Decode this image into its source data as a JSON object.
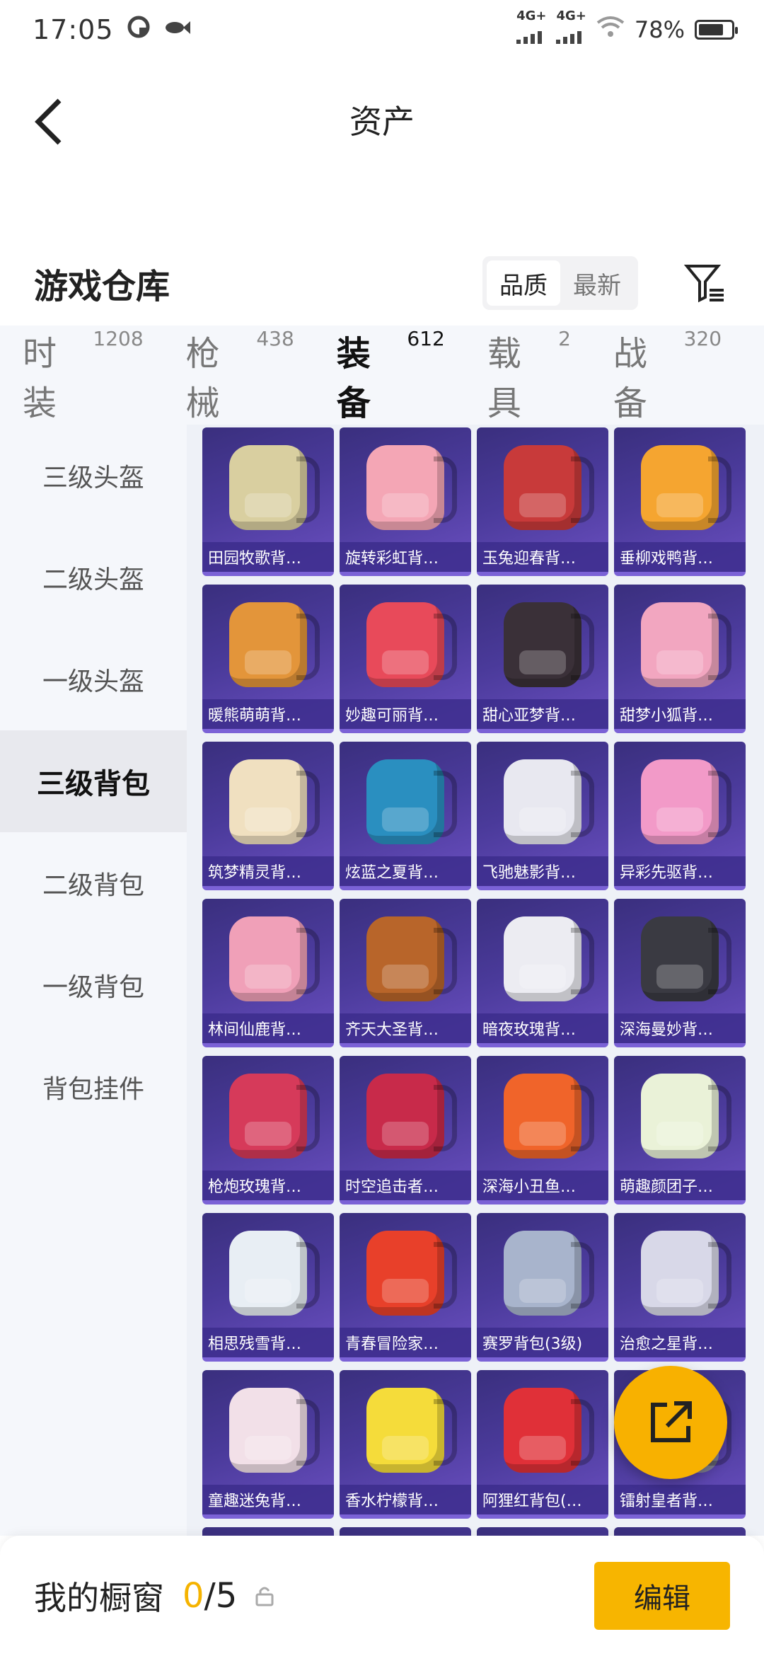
{
  "status": {
    "time": "17:05",
    "signal1": "4G+",
    "signal2": "4G+",
    "battery": "78%",
    "battery_level": 0.78
  },
  "header": {
    "title": "资产",
    "back_icon": "chevron-left-icon"
  },
  "warehouse": {
    "title": "游戏仓库",
    "sort_options": [
      "品质",
      "最新"
    ],
    "filter_icon": "filter-icon"
  },
  "tabs": [
    {
      "label": "时装",
      "count": "1208"
    },
    {
      "label": "枪械",
      "count": "438"
    },
    {
      "label": "装备",
      "count": "612"
    },
    {
      "label": "载具",
      "count": "2"
    },
    {
      "label": "战备",
      "count": "320"
    }
  ],
  "sidebar": {
    "items": [
      "三级头盔",
      "二级头盔",
      "一级头盔",
      "三级背包",
      "二级背包",
      "一级背包",
      "背包挂件"
    ]
  },
  "items": [
    {
      "name": "田园牧歌背…",
      "color": "#d9cfa0"
    },
    {
      "name": "旋转彩虹背…",
      "color": "#f4a6b5"
    },
    {
      "name": "玉兔迎春背…",
      "color": "#c83a3a"
    },
    {
      "name": "垂柳戏鸭背…",
      "color": "#f5a530"
    },
    {
      "name": "暖熊萌萌背…",
      "color": "#e3953a"
    },
    {
      "name": "妙趣可丽背…",
      "color": "#e84a5a"
    },
    {
      "name": "甜心亚梦背…",
      "color": "#3a3038"
    },
    {
      "name": "甜梦小狐背…",
      "color": "#f2a6c0"
    },
    {
      "name": "筑梦精灵背…",
      "color": "#f0e0c0"
    },
    {
      "name": "炫蓝之夏背…",
      "color": "#2a8fc0"
    },
    {
      "name": "飞驰魅影背…",
      "color": "#e8e8f0"
    },
    {
      "name": "异彩先驱背…",
      "color": "#f29ac8"
    },
    {
      "name": "林间仙鹿背…",
      "color": "#f0a0b8"
    },
    {
      "name": "齐天大圣背…",
      "color": "#b8652a"
    },
    {
      "name": "暗夜玫瑰背…",
      "color": "#ececf2"
    },
    {
      "name": "深海曼妙背…",
      "color": "#3a3a42"
    },
    {
      "name": "枪炮玫瑰背…",
      "color": "#d63a5a"
    },
    {
      "name": "时空追击者…",
      "color": "#c82a4a"
    },
    {
      "name": "深海小丑鱼…",
      "color": "#f0642a"
    },
    {
      "name": "萌趣颜团子…",
      "color": "#eaf2d8"
    },
    {
      "name": "相思残雪背…",
      "color": "#e8eef4"
    },
    {
      "name": "青春冒险家…",
      "color": "#e8402a"
    },
    {
      "name": "赛罗背包(3级)",
      "color": "#a8b4cc"
    },
    {
      "name": "治愈之星背…",
      "color": "#d8d8e8"
    },
    {
      "name": "童趣迷兔背…",
      "color": "#f2e0e8"
    },
    {
      "name": "香水柠檬背…",
      "color": "#f5dc3a"
    },
    {
      "name": "阿狸红背包(…",
      "color": "#e03038"
    },
    {
      "name": "镭射皇者背…",
      "color": "#9a9ab0"
    }
  ],
  "fab": {
    "icon": "share-external-icon"
  },
  "bottom": {
    "label": "我的橱窗",
    "count_current": "0",
    "count_total": "/5",
    "edit_label": "编辑"
  },
  "colors": {
    "accent": "#f7b500",
    "card_bg": "#4a3a9a",
    "card_label_bg": "#3c2d8c"
  }
}
